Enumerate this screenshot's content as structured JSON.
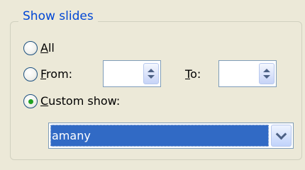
{
  "group": {
    "title": "Show slides"
  },
  "options": {
    "all": {
      "label_underline": "A",
      "label_rest": "ll",
      "checked": false
    },
    "from": {
      "label_underline": "F",
      "label_rest": "rom:",
      "checked": false
    },
    "custom": {
      "label_underline": "C",
      "label_rest": "ustom show:",
      "checked": true
    }
  },
  "from_field": {
    "value": ""
  },
  "to": {
    "label_underline": "T",
    "label_rest": "o:",
    "value": ""
  },
  "custom_show": {
    "selected": "amany"
  },
  "colors": {
    "group_title": "#0046d5",
    "selection": "#316ac5",
    "radio_dot": "#21a121"
  }
}
